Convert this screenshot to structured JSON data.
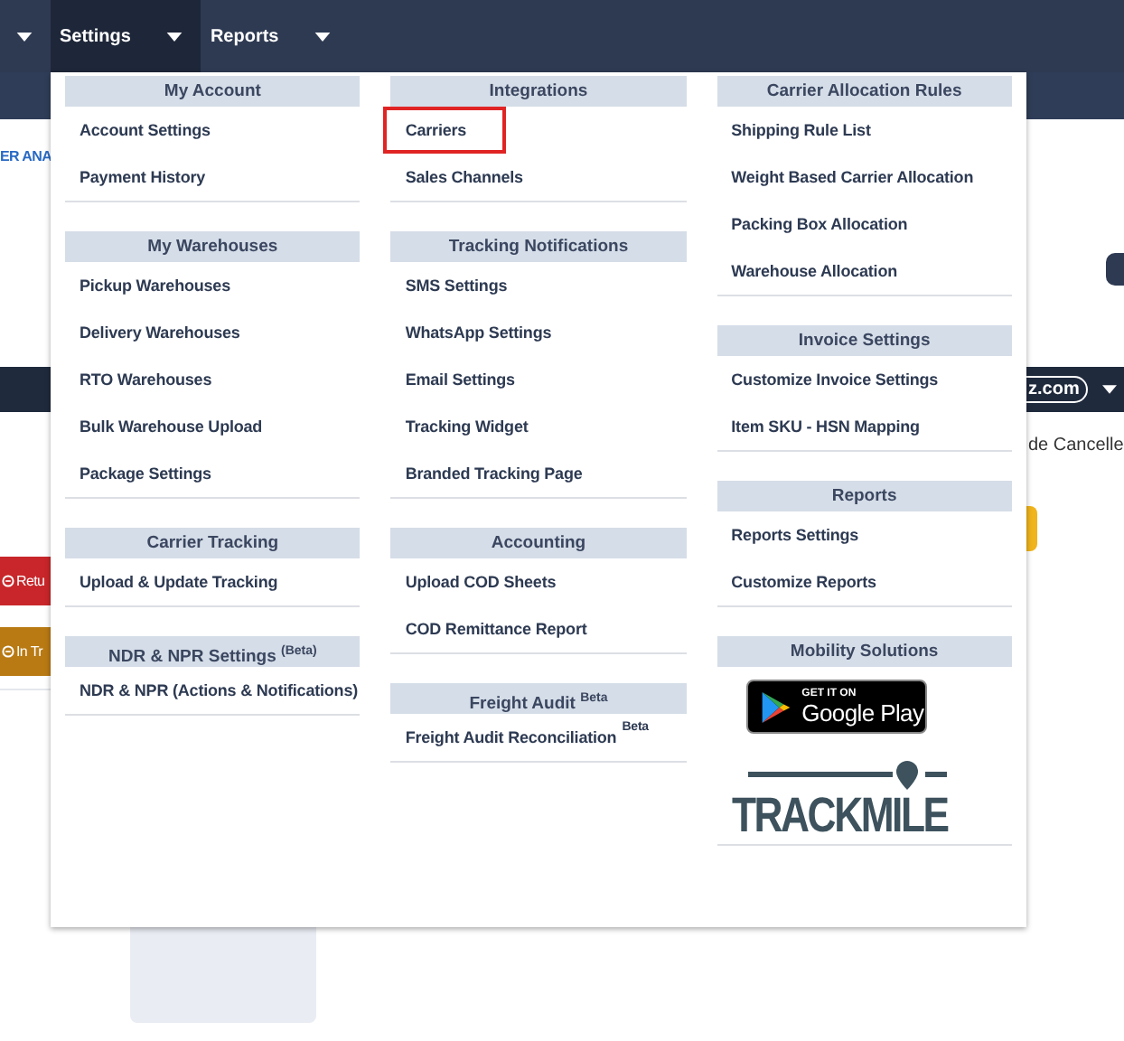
{
  "nav": {
    "menus": [
      {
        "label": "Settings",
        "selected": true
      },
      {
        "label": "Reports",
        "selected": false
      }
    ]
  },
  "page_behind": {
    "link_text": "ER ANA",
    "account_chip": "z.com",
    "status_text": "de Cancelle",
    "buttons": [
      {
        "label": "Retu",
        "color": "#c8262a"
      },
      {
        "label": "In Tr",
        "color": "#b97a14"
      }
    ]
  },
  "settings_menu": {
    "columns": [
      {
        "sections": [
          {
            "title": "My Account",
            "items": [
              {
                "kind": "link",
                "label": "Account Settings",
                "outlined": false
              },
              {
                "kind": "link",
                "label": "Payment History",
                "outlined": false
              }
            ]
          },
          {
            "title": "My Warehouses",
            "items": [
              {
                "kind": "link",
                "label": "Pickup Warehouses",
                "outlined": false
              },
              {
                "kind": "link",
                "label": "Delivery Warehouses",
                "outlined": false
              },
              {
                "kind": "link",
                "label": "RTO Warehouses",
                "outlined": false
              },
              {
                "kind": "link",
                "label": "Bulk Warehouse Upload",
                "outlined": false
              },
              {
                "kind": "link",
                "label": "Package Settings",
                "outlined": false
              }
            ]
          },
          {
            "title": "Carrier Tracking",
            "items": [
              {
                "kind": "link",
                "label": "Upload & Update Tracking",
                "outlined": false
              }
            ]
          },
          {
            "title": "NDR & NPR Settings $^{(Beta)}$",
            "items": [
              {
                "kind": "link",
                "label": "NDR & NPR (Actions & Notifications)",
                "outlined": false
              }
            ]
          }
        ]
      },
      {
        "sections": [
          {
            "title": "Integrations",
            "items": [
              {
                "kind": "link",
                "label": "Carriers",
                "outlined": true
              },
              {
                "kind": "link",
                "label": "Sales Channels",
                "outlined": false
              }
            ]
          },
          {
            "title": "Tracking Notifications",
            "items": [
              {
                "kind": "link",
                "label": "SMS Settings",
                "outlined": false
              },
              {
                "kind": "link",
                "label": "WhatsApp Settings",
                "outlined": false
              },
              {
                "kind": "link",
                "label": "Email Settings",
                "outlined": false
              },
              {
                "kind": "link",
                "label": "Tracking Widget",
                "outlined": false
              },
              {
                "kind": "link",
                "label": "Branded Tracking Page",
                "outlined": false
              }
            ]
          },
          {
            "title": "Accounting",
            "items": [
              {
                "kind": "link",
                "label": "Upload COD Sheets",
                "outlined": false
              },
              {
                "kind": "link",
                "label": "COD Remittance Report",
                "outlined": false
              }
            ]
          },
          {
            "title": "Freight Audit $^{Beta}$",
            "items": [
              {
                "kind": "link",
                "label": "Freight Audit Reconciliation $^{Beta}$",
                "outlined": false
              }
            ]
          }
        ]
      },
      {
        "sections": [
          {
            "title": "Carrier Allocation Rules",
            "items": [
              {
                "kind": "link",
                "label": "Shipping Rule List",
                "outlined": false
              },
              {
                "kind": "link",
                "label": "Weight Based Carrier Allocation",
                "outlined": false
              },
              {
                "kind": "link",
                "label": "Packing Box Allocation",
                "outlined": false
              },
              {
                "kind": "link",
                "label": "Warehouse Allocation",
                "outlined": false
              }
            ]
          },
          {
            "title": "Invoice Settings",
            "items": [
              {
                "kind": "link",
                "label": "Customize Invoice Settings",
                "outlined": false
              },
              {
                "kind": "link",
                "label": "Item SKU - HSN Mapping",
                "outlined": false
              }
            ]
          },
          {
            "title": "Reports",
            "items": [
              {
                "kind": "link",
                "label": "Reports Settings",
                "outlined": false
              },
              {
                "kind": "link",
                "label": "Customize Reports",
                "outlined": false
              }
            ]
          },
          {
            "title": "Mobility Solutions",
            "items": [
              {
                "kind": "store_badge",
                "small": "GET IT ON",
                "large": "Google Play"
              },
              {
                "kind": "logo",
                "label": "TRACKMILE"
              }
            ]
          }
        ]
      }
    ]
  }
}
